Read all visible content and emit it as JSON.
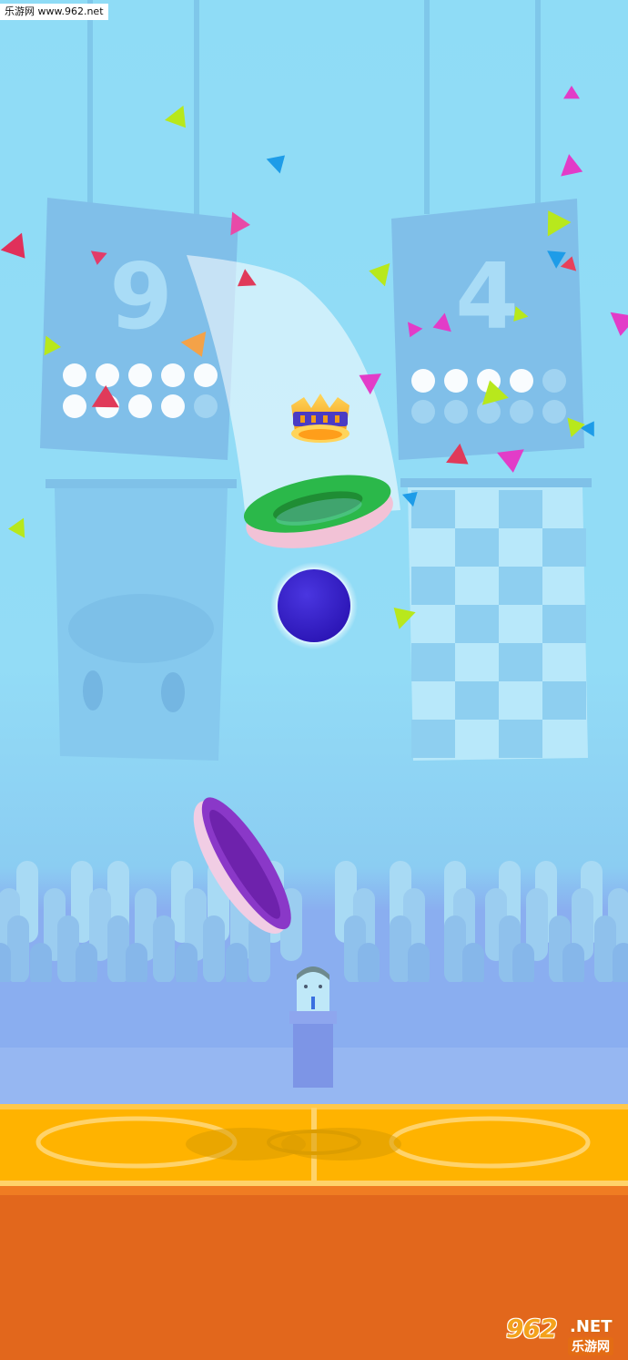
{
  "watermark": {
    "site_label": "乐游网 www.962.net"
  },
  "logo": {
    "number": "962",
    "domain": ".NET",
    "brand": "乐游网"
  },
  "scoreboards": {
    "left": {
      "score": "9",
      "lights_lit": 9,
      "lights_total": 10
    },
    "right": {
      "score": "4",
      "lights_lit": 4,
      "lights_total": 10
    }
  },
  "colors": {
    "sky": "#8fdcf6",
    "ball": "#3a22c8",
    "target_ring": "#2bb84a",
    "player_ring": "#8a38c8",
    "court": "#ffb300",
    "floor": "#e2671c",
    "crown": "#f7b81b"
  },
  "icons": {
    "crown": "crown-icon",
    "ball": "ball-icon"
  }
}
